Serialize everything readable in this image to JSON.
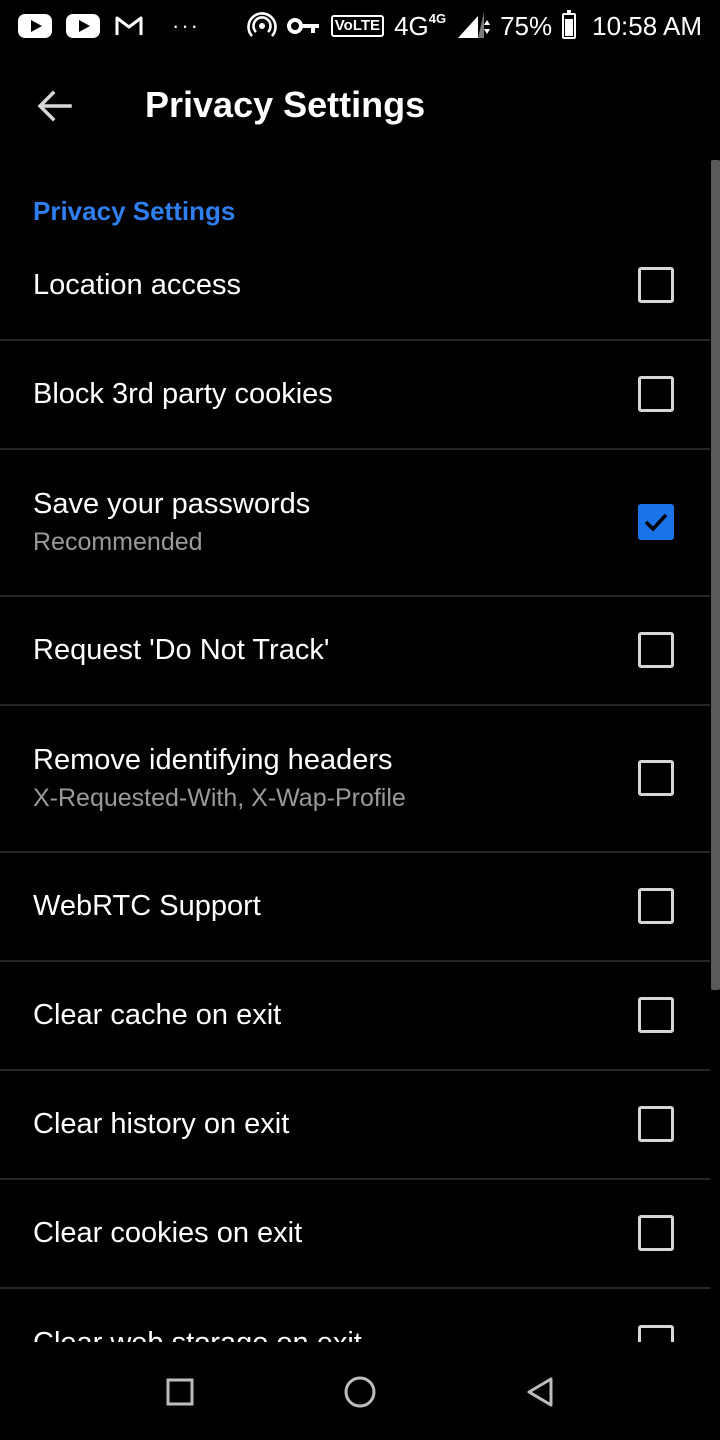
{
  "status_bar": {
    "icons": [
      "youtube-icon",
      "youtube-icon",
      "gmail-icon",
      "more-dots-icon",
      "hotspot-icon",
      "vpn-key-icon",
      "volte-icon",
      "signal-icon",
      "battery-icon"
    ],
    "dots": "···",
    "volte": "VoLTE",
    "network": "4G",
    "network_small": "4G",
    "battery": "75%",
    "time": "10:58 AM"
  },
  "app_bar": {
    "title": "Privacy Settings",
    "back_icon": "arrow-back-icon"
  },
  "section": {
    "header": "Privacy Settings"
  },
  "settings": [
    {
      "title": "Location access",
      "subtitle": "",
      "checked": false
    },
    {
      "title": "Block 3rd party cookies",
      "subtitle": "",
      "checked": false
    },
    {
      "title": "Save your passwords",
      "subtitle": "Recommended",
      "checked": true
    },
    {
      "title": "Request 'Do Not Track'",
      "subtitle": "",
      "checked": false
    },
    {
      "title": "Remove identifying headers",
      "subtitle": "X-Requested-With, X-Wap-Profile",
      "checked": false
    },
    {
      "title": "WebRTC Support",
      "subtitle": "",
      "checked": false
    },
    {
      "title": "Clear cache on exit",
      "subtitle": "",
      "checked": false
    },
    {
      "title": "Clear history on exit",
      "subtitle": "",
      "checked": false
    },
    {
      "title": "Clear cookies on exit",
      "subtitle": "",
      "checked": false
    },
    {
      "title": "Clear web storage on exit",
      "subtitle": "",
      "checked": false
    }
  ],
  "nav_bar": {
    "icons": [
      "recents-square-icon",
      "home-circle-icon",
      "back-triangle-icon"
    ]
  },
  "colors": {
    "accent": "#2f7ff0",
    "checkbox_checked": "#1a73e8",
    "background": "#000000"
  }
}
